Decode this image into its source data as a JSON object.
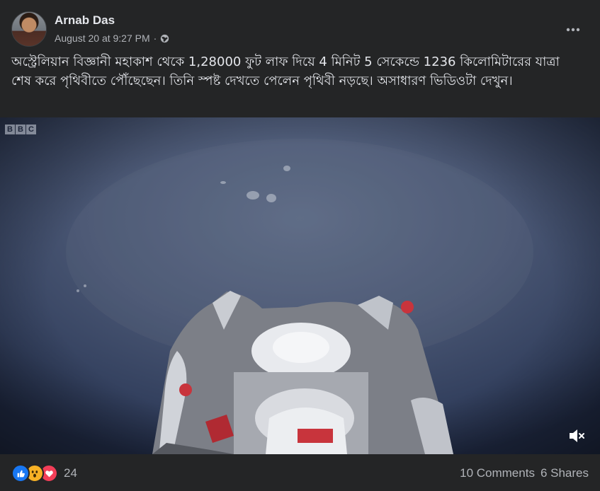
{
  "post": {
    "author": "Arnab Das",
    "timestamp": "August 20 at 9:27 PM",
    "separator": "·",
    "privacy_icon": "globe-icon",
    "more_icon": "more-options-icon",
    "text": "অস্ট্রেলিয়ান বিজ্ঞানী মহাকাশ থেকে 1,28000 ফুট লাফ দিয়ে 4 মিনিট 5 সেকেন্ডে 1236 কিলোমিটারের যাত্রা শেষ করে পৃথিবীতে পৌঁছেছেন। তিনি স্পষ্ট দেখতে পেলেন পৃথিবী নড়ছে। অসাধারণ ভিডিওটা দেখুন।"
  },
  "video": {
    "watermark": [
      "B",
      "B",
      "C"
    ],
    "mute_icon": "volume-muted-icon"
  },
  "footer": {
    "reactions": [
      "like-icon",
      "wow-icon",
      "love-icon"
    ],
    "reaction_count": "24",
    "comments": "10 Comments",
    "shares": "6 Shares"
  },
  "colors": {
    "card_bg": "#242526",
    "text_primary": "#e4e6eb",
    "text_secondary": "#b0b3b8",
    "like_blue": "#1877f2",
    "wow_yellow": "#f7b125",
    "love_red": "#f33e58"
  }
}
